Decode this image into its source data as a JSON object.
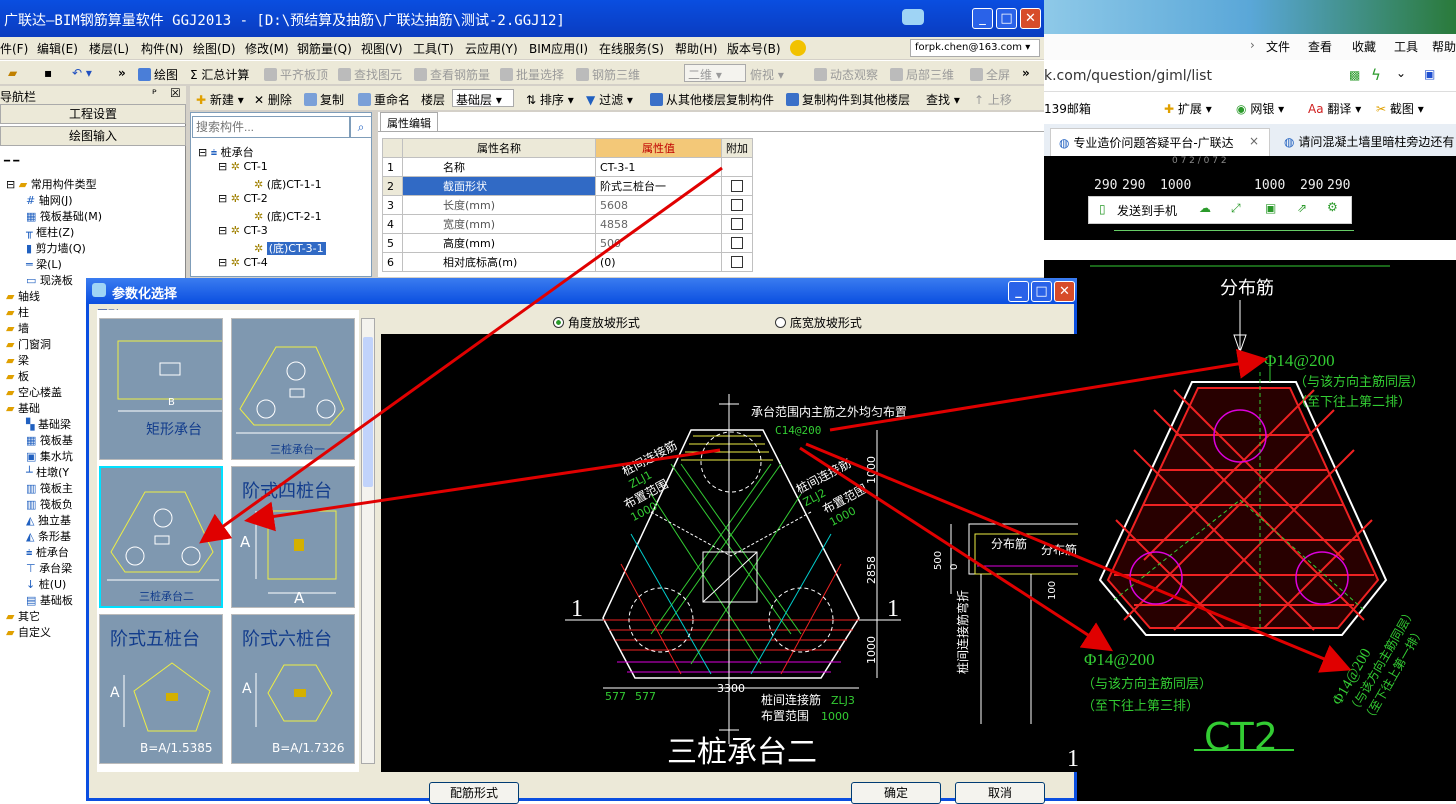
{
  "main_window": {
    "title": "广联达—BIM钢筋算量软件 GGJ2013 - [D:\\预结算及抽筋\\广联达抽筋\\测试-2.GGJ12]",
    "menu": [
      "件(F)",
      "编辑(E)",
      "楼层(L)",
      "构件(N)",
      "绘图(D)",
      "修改(M)",
      "钢筋量(Q)",
      "视图(V)",
      "工具(T)",
      "云应用(Y)",
      "BIM应用(I)",
      "在线服务(S)",
      "帮助(H)",
      "版本号(B)"
    ],
    "account": "forpk.chen@163.com",
    "toolbar1": {
      "draw": "绘图",
      "summary": "Σ 汇总计算",
      "flat_top": "平齐板顶",
      "find_elem": "查找图元",
      "view_rebar": "查看钢筋量",
      "batch_select": "批量选择",
      "rebar_3d": "钢筋三维",
      "dim_2d": "二维",
      "top_view": "俯视",
      "dynamic": "动态观察",
      "local_3d": "局部三维",
      "fullscreen": "全屏"
    },
    "nav": {
      "title": "导航栏",
      "project_settings": "工程设置",
      "drawing_input": "绘图输入",
      "tree": [
        "常用构件类型",
        "轴网(J)",
        "筏板基础(M)",
        "框柱(Z)",
        "剪力墙(Q)",
        "梁(L)",
        "现浇板",
        "轴线",
        "柱",
        "墙",
        "门窗洞",
        "梁",
        "板",
        "空心楼盖",
        "基础",
        "基础梁",
        "筏板基",
        "集水坑",
        "柱墩(Y",
        "筏板主",
        "筏板负",
        "独立基",
        "条形基",
        "桩承台",
        "承台梁",
        "桩(U)",
        "基础板",
        "其它",
        "自定义"
      ]
    },
    "toolbar2": {
      "new": "新建",
      "delete": "删除",
      "copy": "复制",
      "rename": "重命名",
      "floor_label": "楼层",
      "floor_value": "基础层",
      "sort": "排序",
      "filter": "过滤",
      "copy_from": "从其他楼层复制构件",
      "copy_to": "复制构件到其他楼层",
      "find": "查找",
      "move_up": "上移"
    },
    "search_placeholder": "搜索构件...",
    "component_tree": [
      "桩承台",
      "CT-1",
      "(底)CT-1-1",
      "CT-2",
      "(底)CT-2-1",
      "CT-3",
      "(底)CT-3-1",
      "CT-4"
    ],
    "prop_tab": "属性编辑",
    "prop_headers": [
      "属性名称",
      "属性值",
      "附加"
    ],
    "props": [
      {
        "n": "1",
        "name": "名称",
        "value": "CT-3-1"
      },
      {
        "n": "2",
        "name": "截面形状",
        "value": "阶式三桩台一"
      },
      {
        "n": "3",
        "name": "长度(mm)",
        "value": "5608"
      },
      {
        "n": "4",
        "name": "宽度(mm)",
        "value": "4858"
      },
      {
        "n": "5",
        "name": "高度(mm)",
        "value": "500"
      },
      {
        "n": "6",
        "name": "相对底标高(m)",
        "value": "(0)"
      }
    ]
  },
  "dialog": {
    "title": "参数化选择",
    "shapes_group": "图形",
    "shapes": [
      "矩形承台",
      "三桩承台一",
      "三桩承台二",
      "阶式四桩台",
      "阶式五桩台",
      "阶式六桩台"
    ],
    "thumb_labels": {
      "b": "B",
      "a": "A",
      "b5": "B=A/1.5385",
      "b6": "B=A/1.7326"
    },
    "radio_angle": "角度放坡形式",
    "radio_width": "底宽放坡形式",
    "cad": {
      "note": "承台范围内主筋之外均匀布置",
      "rebar": "C14@200",
      "left_a": "桩间连接筋",
      "left_b": "ZLJ1",
      "left_c": "布置范围",
      "left_d": "1000",
      "right_a": "桩间连接筋",
      "right_b": "ZLJ2",
      "right_c": "布置范围",
      "right_d": "1000",
      "bot_a": "桩间连接筋",
      "bot_b": "ZLJ3",
      "bot_c": "布置范围",
      "bot_d": "1000",
      "dims": [
        "1000",
        "2858",
        "1000",
        "577",
        "577",
        "3300"
      ],
      "sec": "1",
      "side_label": "桩间连接筋弯折",
      "dist1": "分布筋",
      "dist2": "分布筋",
      "d500": "500",
      "d0": "0",
      "d100": "100",
      "caption": "三桩承台二"
    },
    "btn_config": "配筋形式",
    "btn_ok": "确定",
    "btn_cancel": "取消"
  },
  "browser": {
    "menu": [
      "文件",
      "查看",
      "收藏",
      "工具",
      "帮助"
    ],
    "url": "k.com/question/giml/list",
    "fav": [
      "139邮箱",
      "扩展",
      "网银",
      "翻译",
      "截图"
    ],
    "tabs": [
      "专业造价问题答疑平台-广联达",
      "请问混凝土墙里暗柱旁边还有"
    ],
    "dims": [
      "290",
      "290",
      "1000",
      "1000",
      "290",
      "290"
    ],
    "send": "发送到手机",
    "cad": {
      "dist": "分布筋",
      "r1": "Φ14@200",
      "r1a": "（与该方向主筋同层）",
      "r1b": "（至下往上第二排）",
      "r2": "Φ14@200",
      "r2a": "（与该方向主筋同层）",
      "r2b": "（至下往上第三排）",
      "r3": "Φ14@200",
      "r3a": "（与该方向主筋同层）",
      "r3b": "（至下往上第一排）",
      "title": "CT2"
    }
  }
}
